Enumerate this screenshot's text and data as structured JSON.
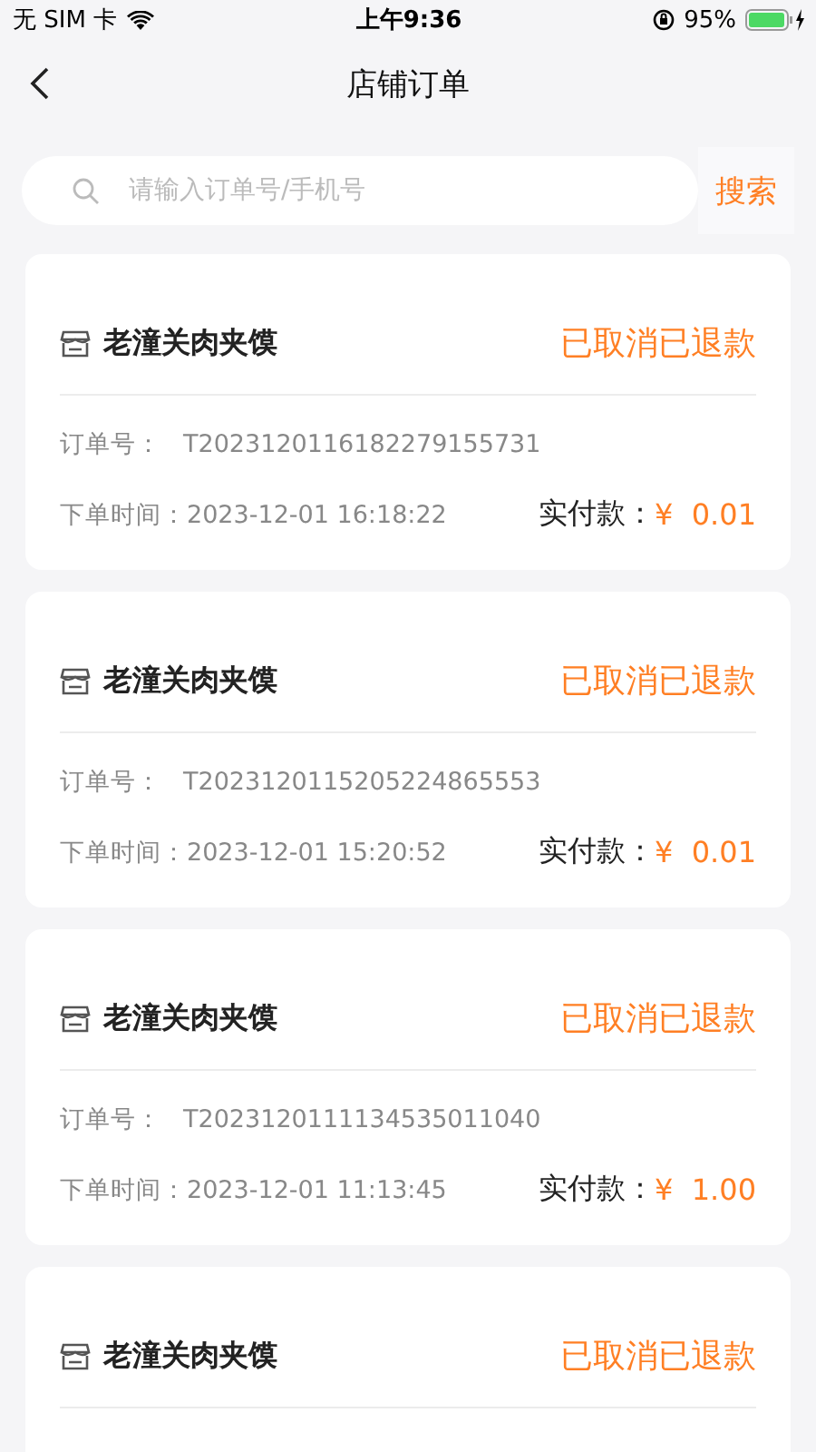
{
  "status_bar": {
    "carrier": "无 SIM 卡",
    "time": "上午9:36",
    "battery": "95%"
  },
  "nav": {
    "title": "店铺订单"
  },
  "search": {
    "placeholder": "请输入订单号/手机号",
    "button": "搜索"
  },
  "orders": [
    {
      "shop": "老潼关肉夹馍",
      "status": "已取消已退款",
      "order_no_label": "订单号：",
      "order_no": "T2023120116182279155731",
      "time_label": "下单时间：",
      "time": "2023-12-01 16:18:22",
      "paid_label": "实付款：",
      "paid": "¥  0.01"
    },
    {
      "shop": "老潼关肉夹馍",
      "status": "已取消已退款",
      "order_no_label": "订单号：",
      "order_no": "T2023120115205224865553",
      "time_label": "下单时间：",
      "time": "2023-12-01 15:20:52",
      "paid_label": "实付款：",
      "paid": "¥  0.01"
    },
    {
      "shop": "老潼关肉夹馍",
      "status": "已取消已退款",
      "order_no_label": "订单号：",
      "order_no": "T2023120111134535011040",
      "time_label": "下单时间：",
      "time": "2023-12-01 11:13:45",
      "paid_label": "实付款：",
      "paid": "¥  1.00"
    },
    {
      "shop": "老潼关肉夹馍",
      "status": "已取消已退款"
    }
  ]
}
